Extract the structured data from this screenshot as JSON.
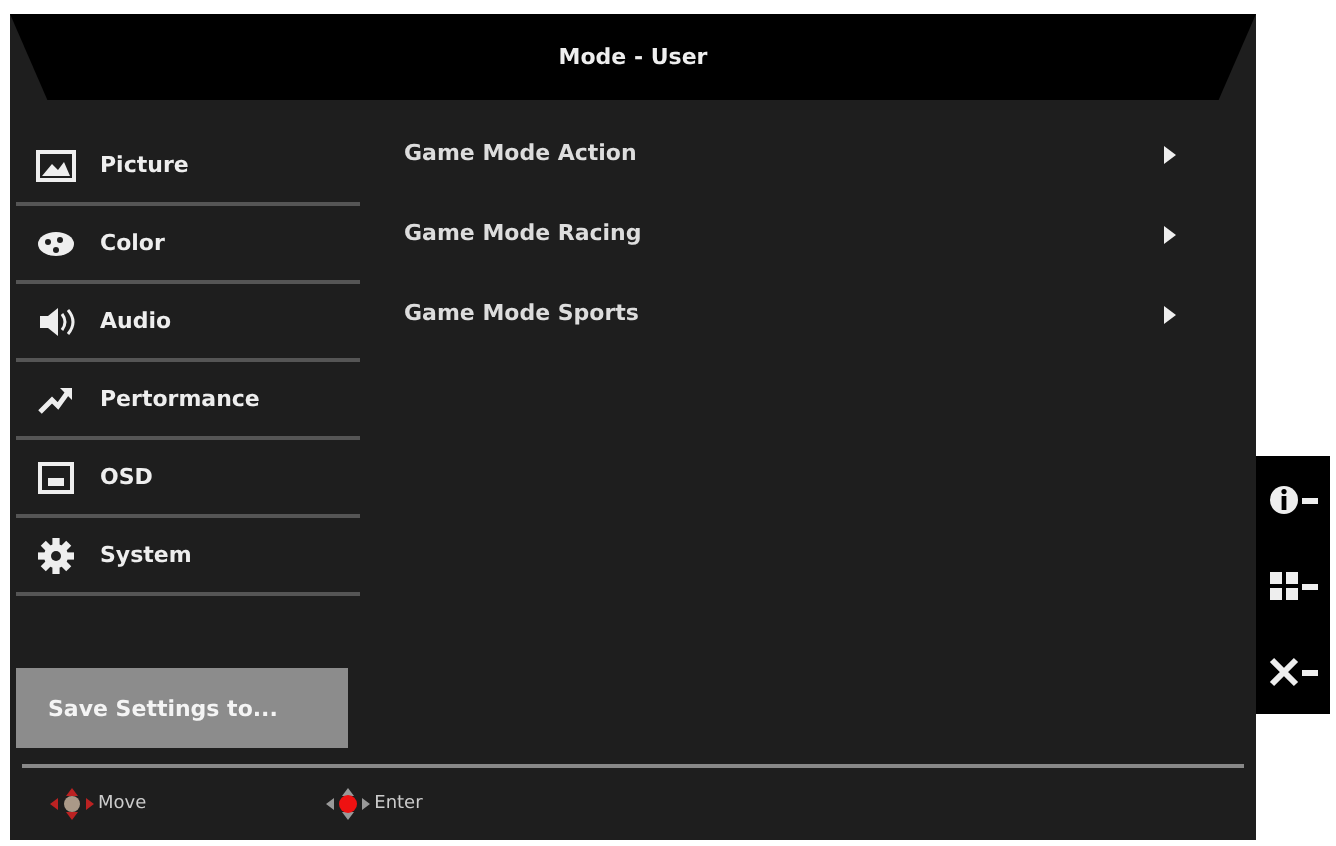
{
  "window": {
    "title": "Mode - User"
  },
  "menu": [
    {
      "label": "Picture",
      "kind": "picture"
    },
    {
      "label": "Color",
      "kind": "color"
    },
    {
      "label": "Audio",
      "kind": "audio"
    },
    {
      "label": "Pertormance",
      "kind": "performance"
    },
    {
      "label": "OSD",
      "kind": "osd"
    },
    {
      "label": "System",
      "kind": "system"
    }
  ],
  "save_button": "Save Settings to...",
  "options": [
    {
      "label": "Game Mode Action"
    },
    {
      "label": "Game Mode Racing"
    },
    {
      "label": "Game Mode Sports"
    }
  ],
  "footer": [
    {
      "label": "Move",
      "kind": "move"
    },
    {
      "label": "Enter",
      "kind": "enter"
    }
  ],
  "side_keys": [
    {
      "kind": "info"
    },
    {
      "kind": "grid"
    },
    {
      "kind": "close"
    }
  ]
}
